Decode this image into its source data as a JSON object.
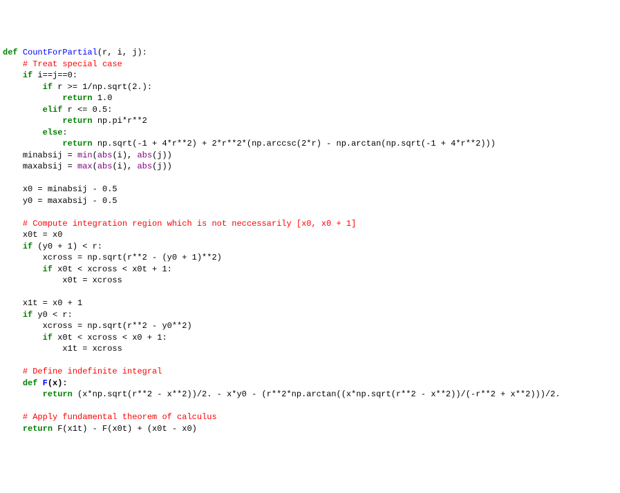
{
  "code": {
    "line1_def": "def",
    "line1_funcname": "CountForPartial",
    "line1_params": "(r, i, j):",
    "line2_comment": "# Treat special case",
    "line3_if": "if",
    "line3_expr": " i==j==0:",
    "line4_if": "if",
    "line4_expr": " r >= 1/np.sqrt(2.):",
    "line5_return": "return",
    "line5_expr": " 1.0",
    "line6_elif": "elif",
    "line6_expr": " r <= 0.5:",
    "line7_return": "return",
    "line7_expr": " np.pi*r**2",
    "line8_else": "else",
    "line8_colon": ":",
    "line9_return": "return",
    "line9_expr": " np.sqrt(-1 + 4*r**2) + 2*r**2*(np.arccsc(2*r) - np.arctan(np.sqrt(-1 + 4*r**2)))",
    "line10_var": "minabsij = ",
    "line10_min": "min",
    "line10_open": "(",
    "line10_abs1": "abs",
    "line10_mid": "(i), ",
    "line10_abs2": "abs",
    "line10_end": "(j))",
    "line11_var": "maxabsij = ",
    "line11_max": "max",
    "line11_open": "(",
    "line11_abs1": "abs",
    "line11_mid": "(i), ",
    "line11_abs2": "abs",
    "line11_end": "(j))",
    "line13": "x0 = minabsij - 0.5",
    "line14": "y0 = maxabsij - 0.5",
    "line16_comment": "# Compute integration region which is not neccessarily [x0, x0 + 1]",
    "line17": "x0t = x0",
    "line18_if": "if",
    "line18_expr": " (y0 + 1) < r:",
    "line19": "xcross = np.sqrt(r**2 - (y0 + 1)**2)",
    "line20_if": "if",
    "line20_expr": " x0t < xcross < x0t + 1:",
    "line21": "x0t = xcross",
    "line23": "x1t = x0 + 1",
    "line24_if": "if",
    "line24_expr": " y0 < r:",
    "line25": "xcross = np.sqrt(r**2 - y0**2)",
    "line26_if": "if",
    "line26_expr": " x0t < xcross < x0 + 1:",
    "line27": "x1t = xcross",
    "line29_comment": "# Define indefinite integral",
    "line30_def": "def",
    "line30_funcname": "F",
    "line30_params": "(x):",
    "line31_return": "return",
    "line31_expr": " (x*np.sqrt(r**2 - x**2))/2. - x*y0 - (r**2*np.arctan((x*np.sqrt(r**2 - x**2))/(-r**2 + x**2)))/2.",
    "line33_comment": "# Apply fundamental theorem of calculus",
    "line34_return": "return",
    "line34_expr": " F(x1t) - F(x0t) + (x0t - x0)"
  }
}
